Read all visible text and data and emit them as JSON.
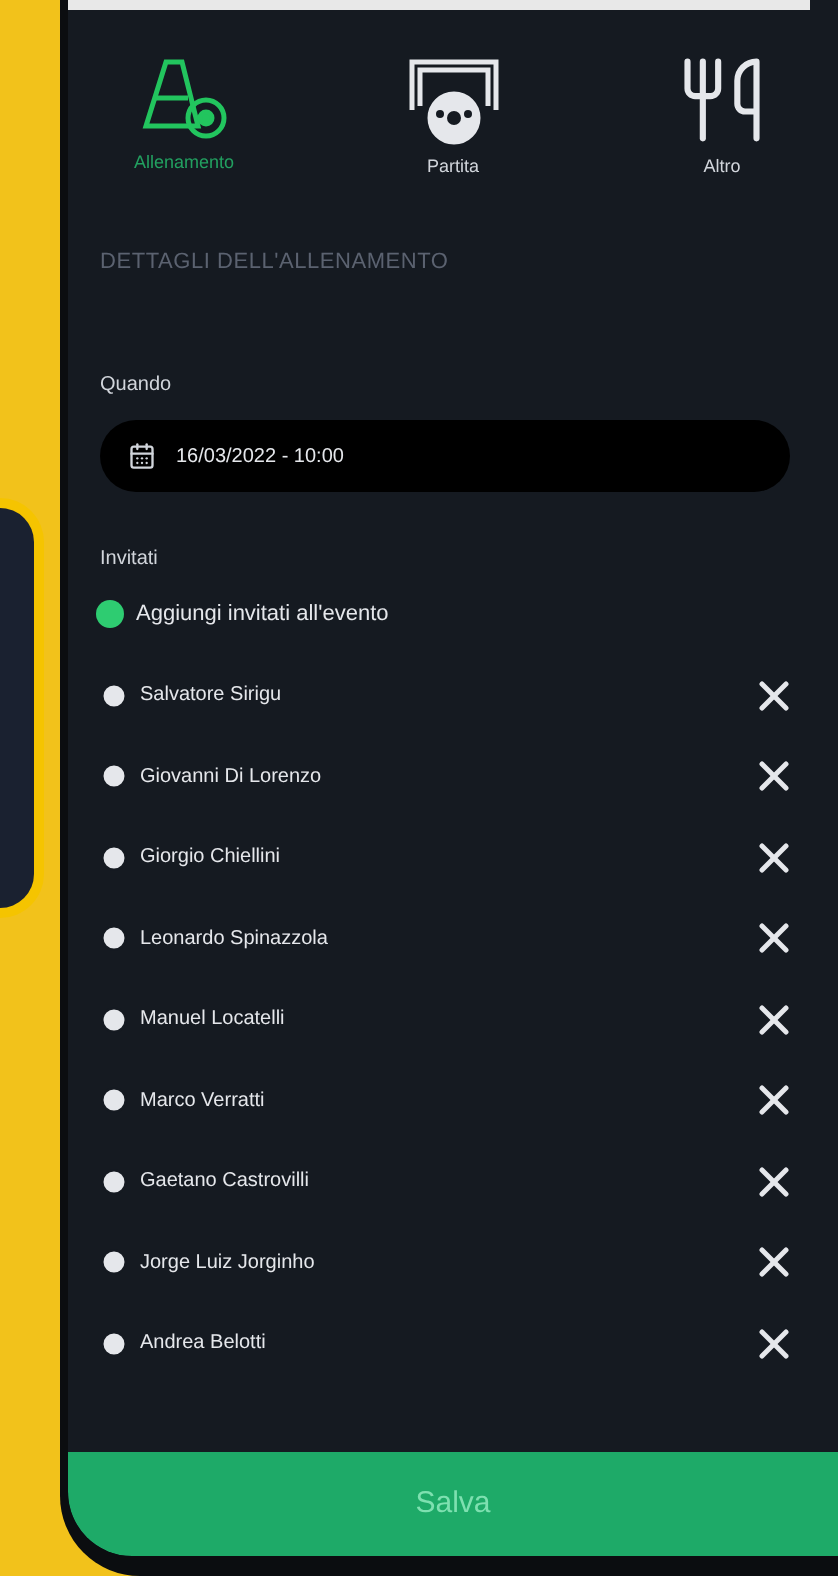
{
  "tabs": [
    {
      "label": "Allenamento",
      "kind": "training",
      "selected": true
    },
    {
      "label": "Partita",
      "kind": "match",
      "selected": false
    },
    {
      "label": "Altro",
      "kind": "other",
      "selected": false
    }
  ],
  "section_title": "DETTAGLI DELL'ALLENAMENTO",
  "when": {
    "label": "Quando",
    "value": "16/03/2022 - 10:00"
  },
  "invited": {
    "label": "Invitati",
    "add_label": "Aggiungi invitati all'evento",
    "people": [
      {
        "name": "Salvatore Sirigu"
      },
      {
        "name": "Giovanni Di Lorenzo"
      },
      {
        "name": "Giorgio Chiellini"
      },
      {
        "name": "Leonardo Spinazzola"
      },
      {
        "name": "Manuel Locatelli"
      },
      {
        "name": "Marco Verratti"
      },
      {
        "name": "Gaetano Castrovilli"
      },
      {
        "name": "Jorge Luiz Jorginho"
      },
      {
        "name": "Andrea Belotti"
      }
    ]
  },
  "save_button": "Salva"
}
